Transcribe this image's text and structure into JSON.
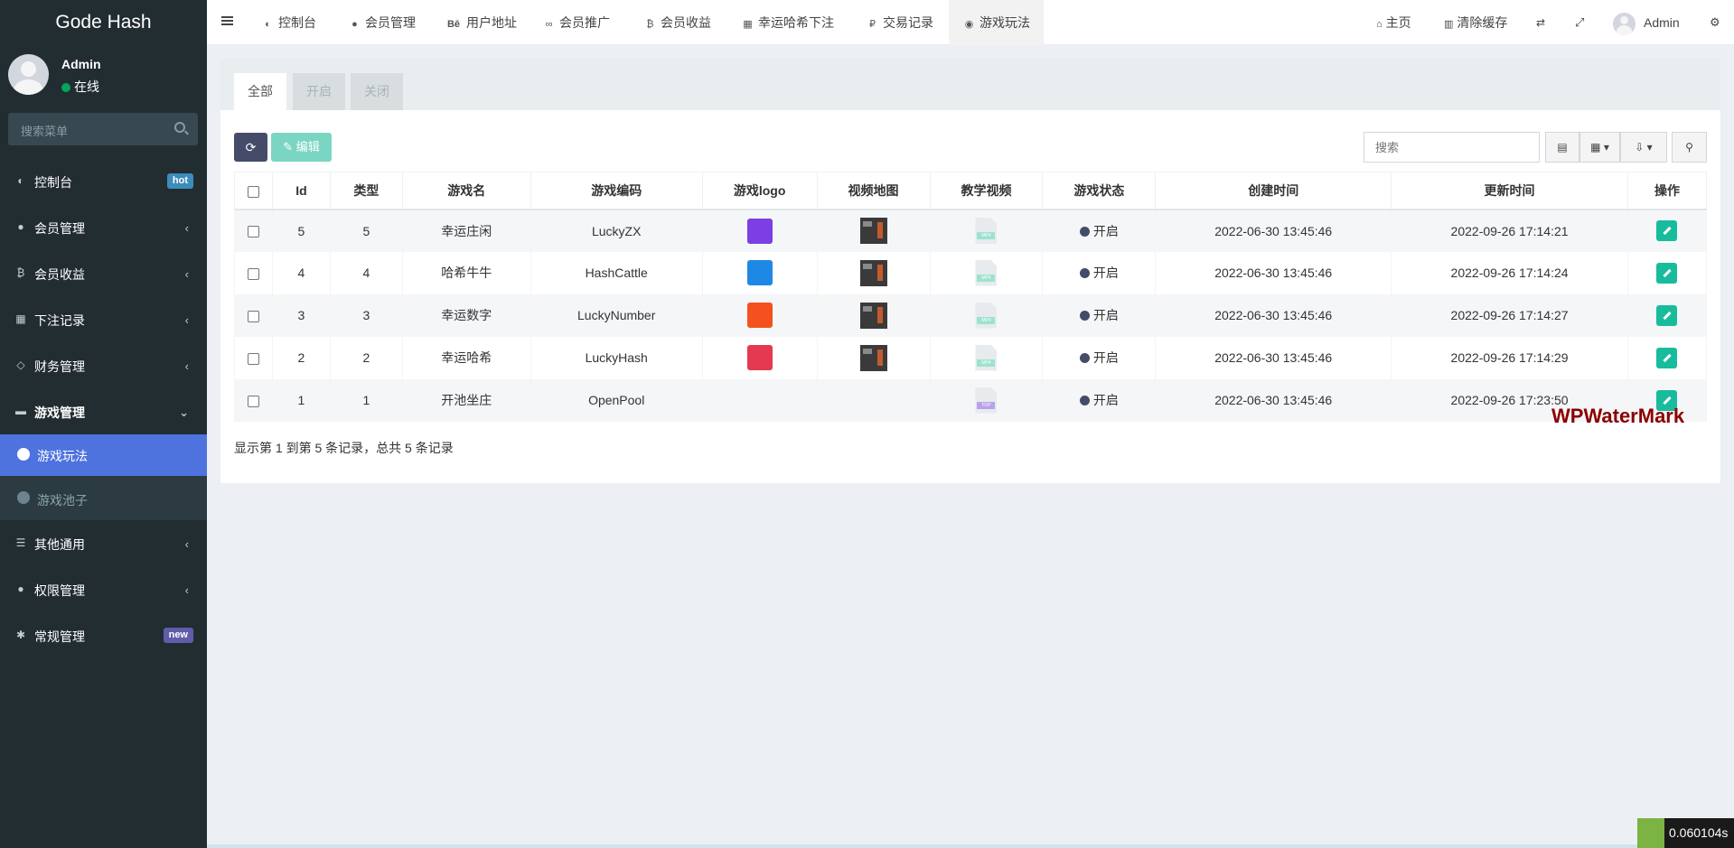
{
  "app": {
    "title": "Gode Hash"
  },
  "user": {
    "name": "Admin",
    "status": "在线"
  },
  "sidebar": {
    "search_placeholder": "搜索菜单",
    "items": [
      {
        "label": "控制台",
        "icon": "dashboard-icon",
        "badge": "hot"
      },
      {
        "label": "会员管理",
        "icon": "user-circle-icon"
      },
      {
        "label": "会员收益",
        "icon": "bitcoin-icon"
      },
      {
        "label": "下注记录",
        "icon": "calendar-icon"
      },
      {
        "label": "财务管理",
        "icon": "diamond-icon"
      },
      {
        "label": "游戏管理",
        "icon": "gamepad-icon",
        "open": true,
        "children": [
          {
            "label": "游戏玩法",
            "active": true
          },
          {
            "label": "游戏池子"
          }
        ]
      },
      {
        "label": "其他通用",
        "icon": "list-icon"
      },
      {
        "label": "权限管理",
        "icon": "users-icon"
      },
      {
        "label": "常规管理",
        "icon": "cogs-icon",
        "badge": "new"
      }
    ]
  },
  "header": {
    "tabs": [
      {
        "label": "控制台",
        "icon": "dashboard-icon"
      },
      {
        "label": "会员管理",
        "icon": "user-icon"
      },
      {
        "label": "用户地址",
        "icon": "behance-icon"
      },
      {
        "label": "会员推广",
        "icon": "handshake-icon"
      },
      {
        "label": "会员收益",
        "icon": "bitcoin-icon"
      },
      {
        "label": "幸运哈希下注",
        "icon": "calendar-check-icon"
      },
      {
        "label": "交易记录",
        "icon": "rouble-icon"
      },
      {
        "label": "游戏玩法",
        "icon": "compass-icon",
        "active": true
      }
    ],
    "right": {
      "home": "主页",
      "clear_cache": "清除缓存",
      "user": "Admin"
    }
  },
  "filter_tabs": [
    "全部",
    "开启",
    "关闭"
  ],
  "toolbar": {
    "edit_label": "编辑",
    "search_placeholder": "搜索"
  },
  "table": {
    "columns": [
      "Id",
      "类型",
      "游戏名",
      "游戏编码",
      "游戏logo",
      "视频地图",
      "教学视频",
      "游戏状态",
      "创建时间",
      "更新时间",
      "操作"
    ],
    "rows": [
      {
        "id": "5",
        "type": "5",
        "name": "幸运庄闲",
        "code": "LuckyZX",
        "logo_color": "#7b3fe4",
        "has_thumb": true,
        "video": "MP4",
        "status": "开启",
        "created": "2022-06-30 13:45:46",
        "updated": "2022-09-26 17:14:21"
      },
      {
        "id": "4",
        "type": "4",
        "name": "哈希牛牛",
        "code": "HashCattle",
        "logo_color": "#1e88e5",
        "has_thumb": true,
        "video": "MP4",
        "status": "开启",
        "created": "2022-06-30 13:45:46",
        "updated": "2022-09-26 17:14:24"
      },
      {
        "id": "3",
        "type": "3",
        "name": "幸运数字",
        "code": "LuckyNumber",
        "logo_color": "#f4511e",
        "has_thumb": true,
        "video": "MP4",
        "status": "开启",
        "created": "2022-06-30 13:45:46",
        "updated": "2022-09-26 17:14:27"
      },
      {
        "id": "2",
        "type": "2",
        "name": "幸运哈希",
        "code": "LuckyHash",
        "logo_color": "#e53950",
        "has_thumb": true,
        "video": "MP4",
        "status": "开启",
        "created": "2022-06-30 13:45:46",
        "updated": "2022-09-26 17:14:29"
      },
      {
        "id": "1",
        "type": "1",
        "name": "开池坐庄",
        "code": "OpenPool",
        "logo_color": "",
        "has_thumb": false,
        "video": "TOP",
        "status": "开启",
        "created": "2022-06-30 13:45:46",
        "updated": "2022-09-26 17:23:50"
      }
    ]
  },
  "summary": "显示第 1 到第 5 条记录，总共 5 条记录",
  "watermark": "WPWaterMark",
  "timer": "0.060104s"
}
